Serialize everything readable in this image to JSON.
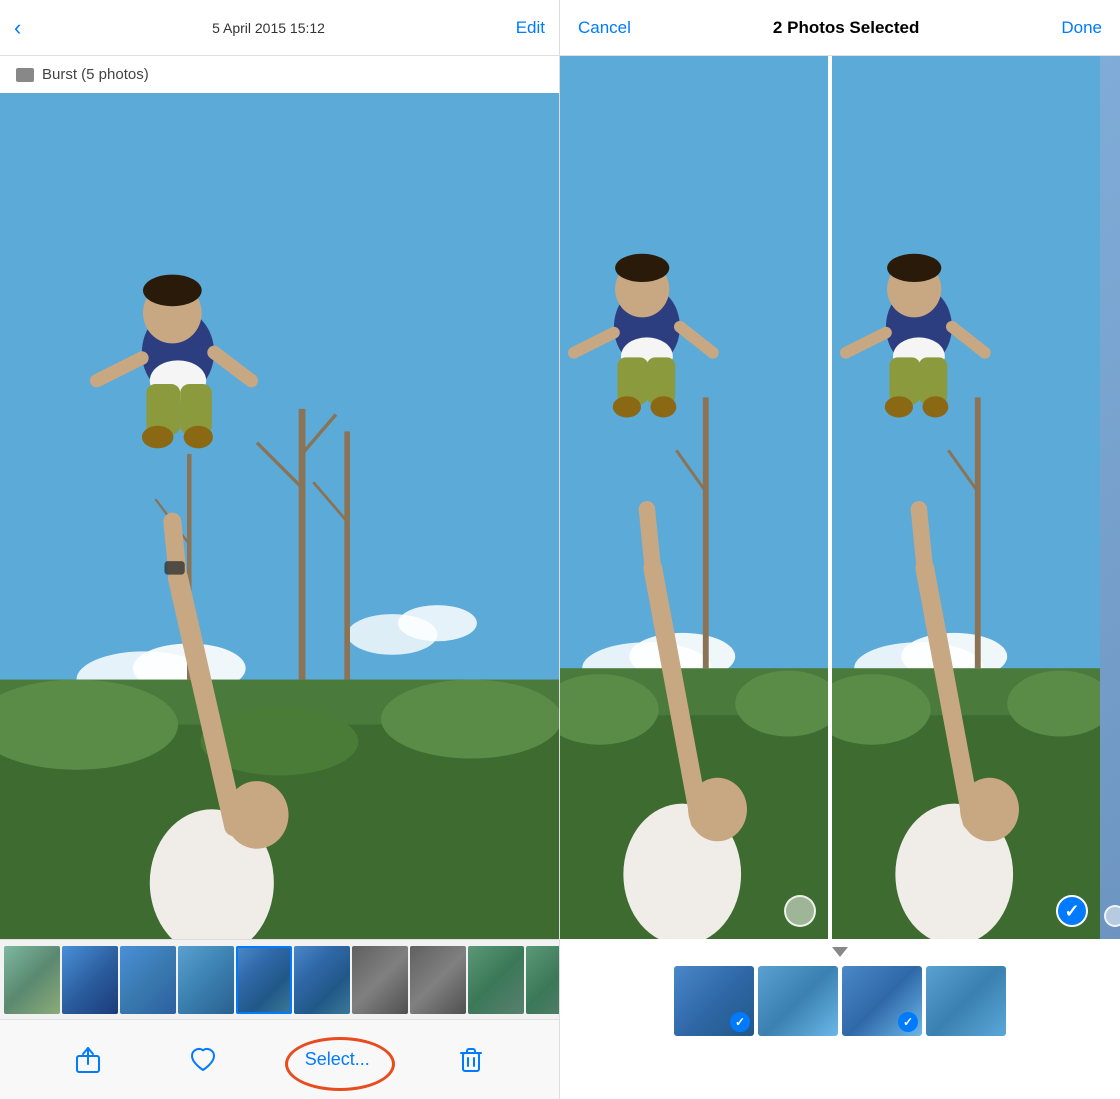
{
  "left": {
    "header": {
      "back_label": "‹",
      "date_label": "5 April 2015  15:12",
      "edit_label": "Edit"
    },
    "burst_label": "Burst (5 photos)",
    "toolbar": {
      "select_label": "Select...",
      "share_label": "Share",
      "heart_label": "Favourite",
      "trash_label": "Delete"
    }
  },
  "right": {
    "header": {
      "cancel_label": "Cancel",
      "title": "2 Photos Selected",
      "done_label": "Done"
    },
    "photos_count": 2
  }
}
